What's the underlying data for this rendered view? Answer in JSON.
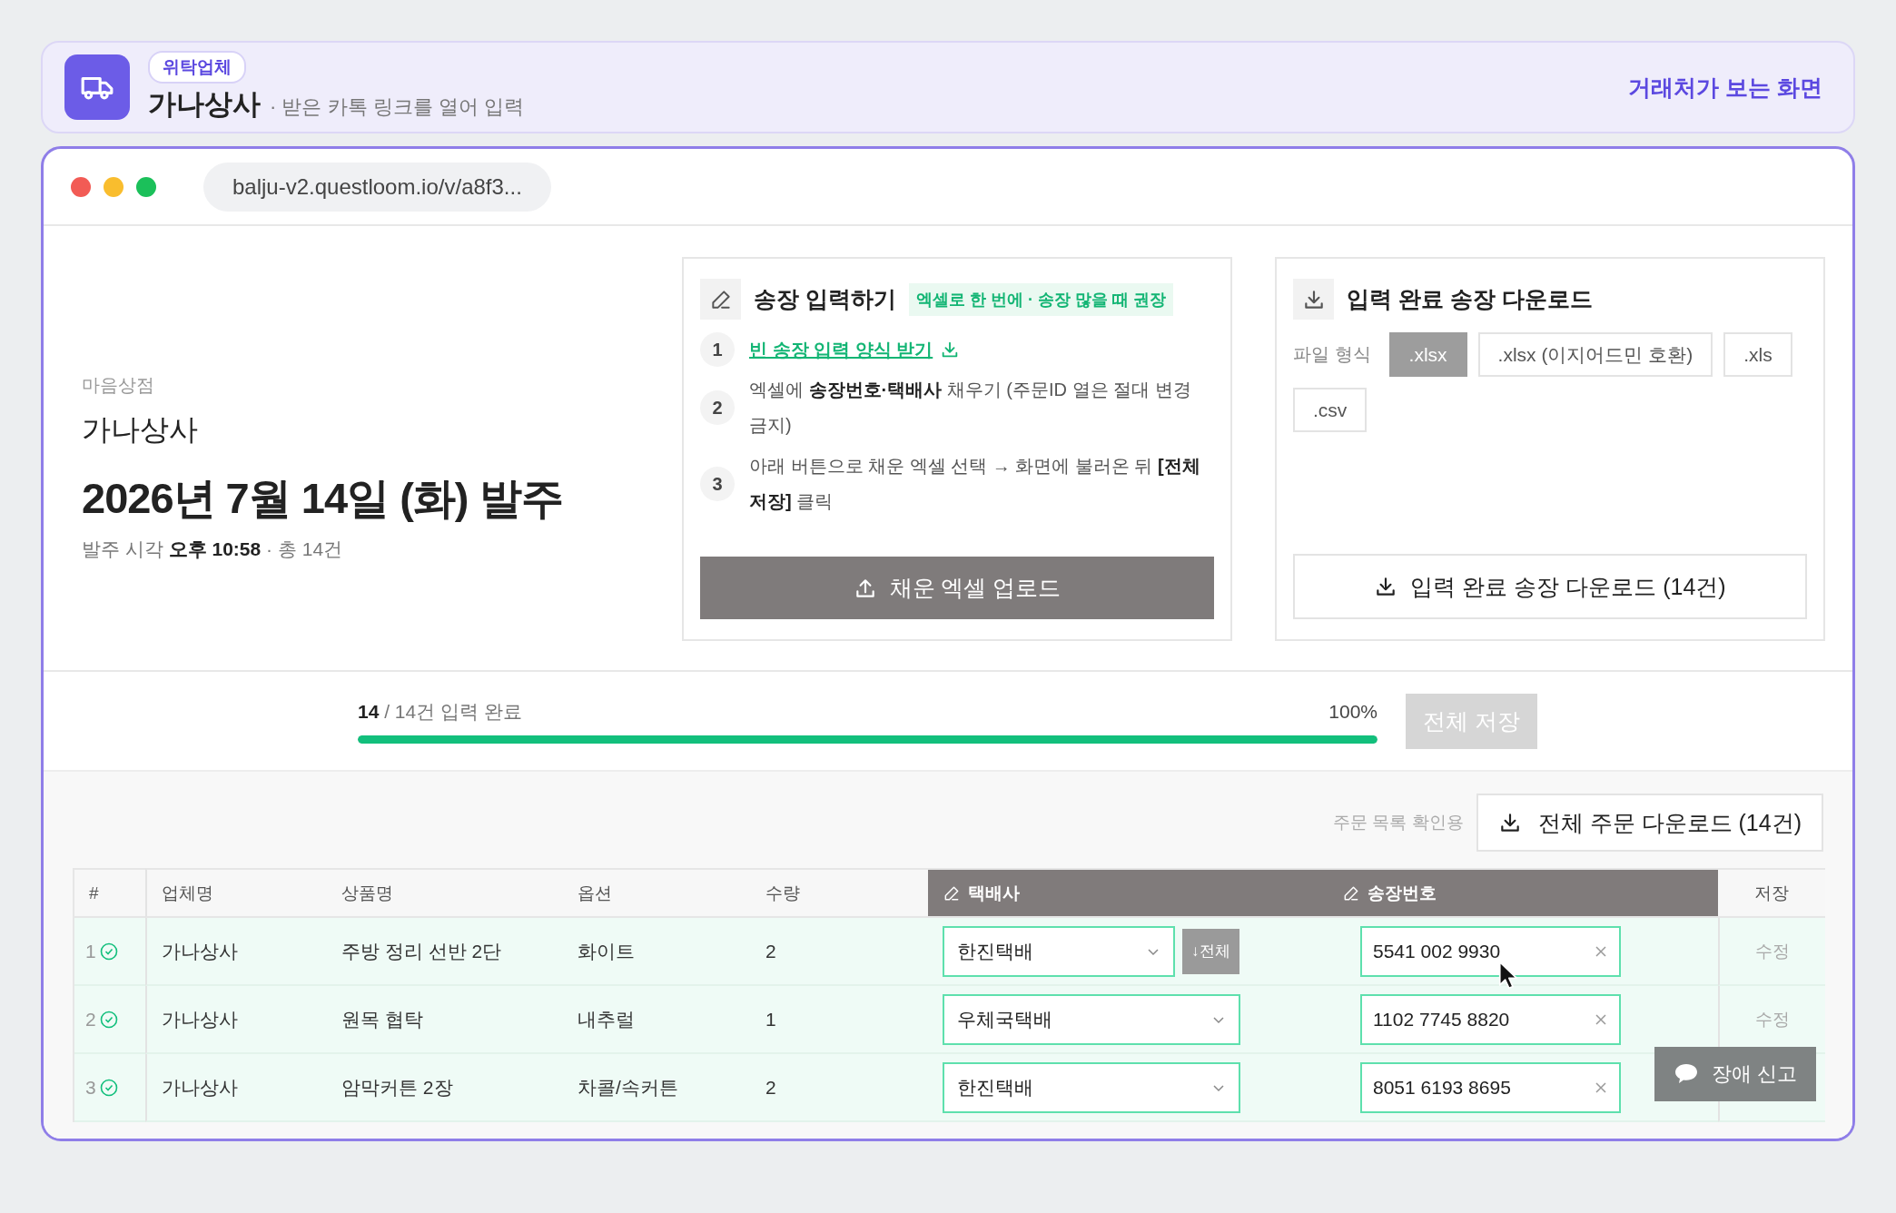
{
  "banner": {
    "badge": "위탁업체",
    "name": "가나상사",
    "subtitle": "· 받은 카톡 링크를 열어 입력",
    "view_link": "거래처가 보는 화면"
  },
  "browser": {
    "url": "balju-v2.questloom.io/v/a8f3..."
  },
  "order": {
    "store": "마음상점",
    "vendor": "가나상사",
    "title": "2026년 7월 14일 (화) 발주",
    "meta": "발주 시각 **오후 10:58** · 총 14건"
  },
  "entry_card": {
    "title": "송장 입력하기",
    "tag": "엑셀로 한 번에 · 송장 많을 때 권장",
    "steps": [
      {
        "number": "1",
        "kind": "link",
        "text": "빈 송장 입력 양식 받기"
      },
      {
        "number": "2",
        "kind": "text",
        "text": "엑셀에 **송장번호·택배사** 채우기 (주문ID 열은 절대 변경 금지)"
      },
      {
        "number": "3",
        "kind": "text",
        "text": "아래 버튼으로 채운 엑셀 선택 → 화면에 불러온 뒤 **[전체 저장]** 클릭"
      }
    ],
    "upload_button": "채운 엑셀 업로드"
  },
  "download_card": {
    "title": "입력 완료 송장 다운로드",
    "format_label": "파일 형식",
    "formats": [
      {
        "label": ".xlsx",
        "selected": true
      },
      {
        "label": ".xlsx (이지어드민 호환)",
        "selected": false
      },
      {
        "label": ".xls",
        "selected": false
      },
      {
        "label": ".csv",
        "selected": false
      }
    ],
    "button": "입력 완료 송장 다운로드 (14건)"
  },
  "progress": {
    "done": "14",
    "total": "/ 14건 입력 완료",
    "level": 1,
    "percent": "100%",
    "save_button": {
      "label": "전체 저장",
      "disabled": true
    }
  },
  "orders_toolbar": {
    "hint": "주문 목록 확인용",
    "button": "전체 주문 다운로드 (14건)"
  },
  "table": {
    "columns": [
      {
        "label": "#",
        "editable": false
      },
      {
        "label": "업체명",
        "editable": false
      },
      {
        "label": "상품명",
        "editable": false
      },
      {
        "label": "옵션",
        "editable": false
      },
      {
        "label": "수량",
        "editable": false
      },
      {
        "label": "택배사",
        "editable": true
      },
      {
        "label": "송장번호",
        "editable": true
      },
      {
        "label": "저장",
        "editable": false
      }
    ],
    "rows": [
      {
        "number": "1",
        "done": true,
        "vendor": "가나상사",
        "product": "주방 정리 선반 2단",
        "option": "화이트",
        "quantity": "2",
        "courier": "한진택배",
        "apply_all": "↓전체",
        "tracking": "5541 002 9930",
        "action": "수정"
      },
      {
        "number": "2",
        "done": true,
        "vendor": "가나상사",
        "product": "원목 협탁",
        "option": "내추럴",
        "quantity": "1",
        "courier": "우체국택배",
        "tracking": "1102 7745 8820",
        "action": "수정"
      },
      {
        "number": "3",
        "done": true,
        "vendor": "가나상사",
        "product": "암막커튼 2장",
        "option": "차콜/속커튼",
        "quantity": "2",
        "courier": "한진택배",
        "tracking": "8051 6193 8695"
      }
    ]
  },
  "report_button": "장애 신고"
}
